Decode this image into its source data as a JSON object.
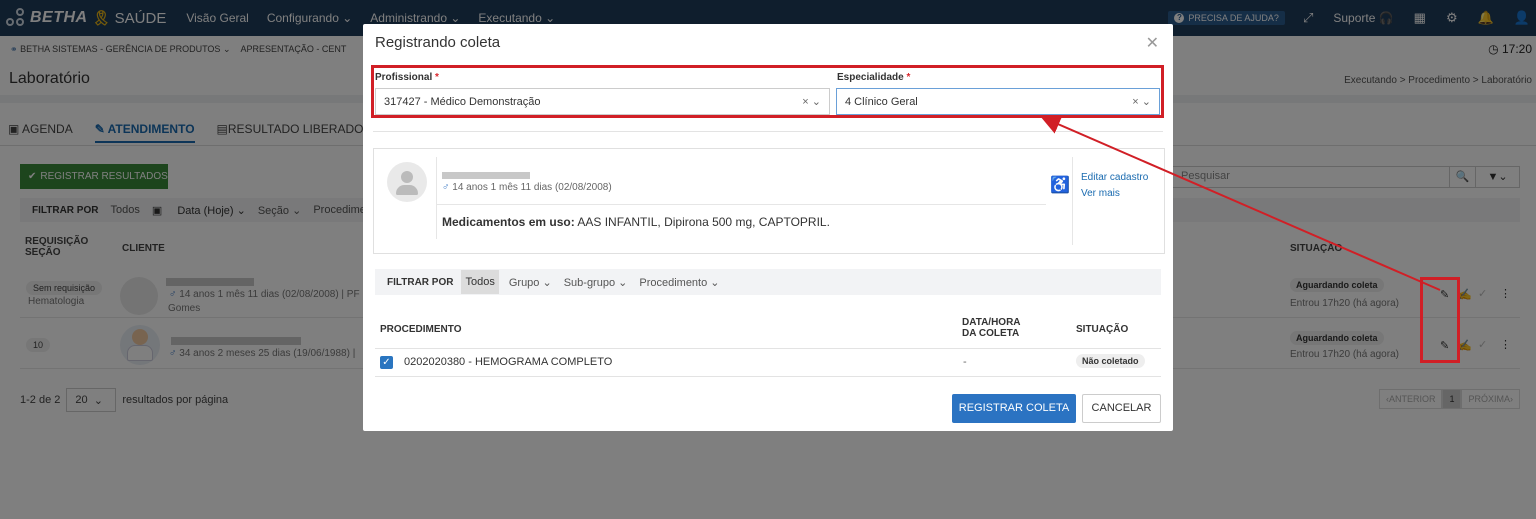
{
  "topbar": {
    "brand_name": "BETHA",
    "brand_product": "SAÚDE",
    "nav": [
      "Visão Geral",
      "Configurando",
      "Administrando",
      "Executando"
    ],
    "help_label": "PRECISA DE AJUDA?",
    "support_label": "Suporte"
  },
  "subheader": {
    "org_label": "BETHA SISTEMAS - GERÊNCIA DE PRODUTOS",
    "context_label": "APRESENTAÇÃO - CENT",
    "clock": "17:20"
  },
  "page": {
    "title": "Laboratório",
    "breadcrumb": "Executando > Procedimento > Laboratório"
  },
  "tabs": [
    "AGENDA",
    "ATENDIMENTO",
    "RESULTADO LIBERADO"
  ],
  "toolbar": {
    "register_results_label": "REGISTRAR RESULTADOS",
    "search_placeholder": "Pesquisar"
  },
  "filters": {
    "label": "FILTRAR POR",
    "items": [
      "Todos",
      "Data (Hoje)",
      "Seção",
      "Procedimen"
    ]
  },
  "table": {
    "headers": {
      "requisicao": "REQUISIÇÃO",
      "secao": "SEÇÃO",
      "cliente": "CLIENTE",
      "situacao": "SITUAÇÃO"
    },
    "rows": [
      {
        "req": "Sem requisição",
        "section": "Hematologia",
        "client_info": "14 anos 1 mês 11 dias (02/08/2008) | PF",
        "client_extra": "Gomes",
        "status": "Aguardando coleta",
        "status_time": "Entrou 17h20 (há agora)"
      },
      {
        "req": "10",
        "section": "",
        "client_info": "34 anos 2 meses 25 dias (19/06/1988) |",
        "client_extra": "",
        "status": "Aguardando coleta",
        "status_time": "Entrou 17h20 (há agora)"
      }
    ]
  },
  "pager": {
    "range": "1-2 de 2",
    "per_page": "20",
    "per_page_label": "resultados por página",
    "prev": "ANTERIOR",
    "current": "1",
    "next": "PRÓXIMA"
  },
  "modal": {
    "title": "Registrando coleta",
    "profissional_label": "Profissional",
    "profissional_value": "317427 - Médico Demonstração",
    "especialidade_label": "Especialidade",
    "especialidade_value": "4 Clínico Geral",
    "patient_age": "14 anos 1 mês 11 dias (02/08/2008)",
    "meds_label": "Medicamentos em uso:",
    "meds_value": "AAS INFANTIL, Dipirona 500 mg, CAPTOPRIL.",
    "edit_link": "Editar cadastro",
    "more_link": "Ver mais",
    "filter_label": "FILTRAR POR",
    "filter_items": [
      "Todos",
      "Grupo",
      "Sub-grupo",
      "Procedimento"
    ],
    "col_procedimento": "PROCEDIMENTO",
    "col_data_1": "DATA/HORA",
    "col_data_2": "DA COLETA",
    "col_situacao": "SITUAÇÃO",
    "proc_row": {
      "name": "0202020380 - HEMOGRAMA COMPLETO",
      "date": "-",
      "status": "Não coletado"
    },
    "confirm_label": "REGISTRAR COLETA",
    "cancel_label": "CANCELAR"
  },
  "colors": {
    "topbar": "#1f3c5a",
    "primary": "#2b73c2",
    "success": "#3a8b3a",
    "annotation": "#d11f26"
  }
}
